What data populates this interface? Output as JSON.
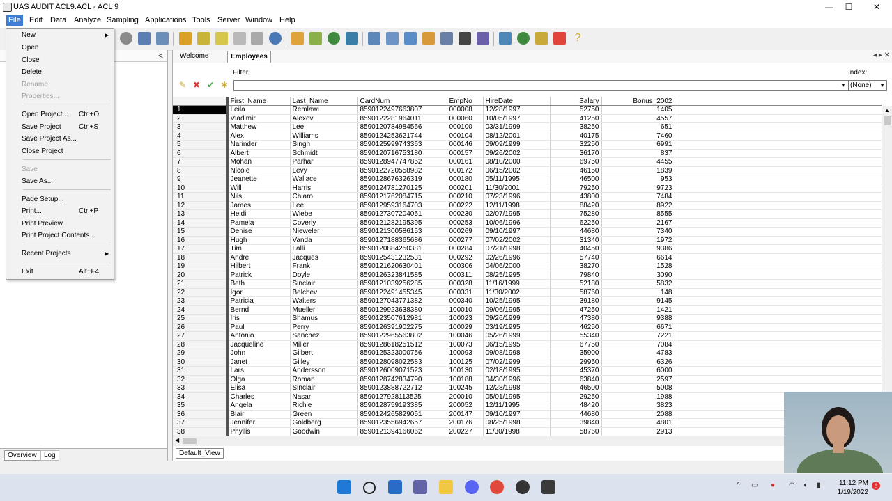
{
  "window": {
    "title": "UAS AUDIT ACL9.ACL - ACL 9",
    "minimize": "—",
    "maximize": "☐",
    "close": "✕"
  },
  "menubar": [
    "File",
    "Edit",
    "Data",
    "Analyze",
    "Sampling",
    "Applications",
    "Tools",
    "Server",
    "Window",
    "Help"
  ],
  "file_menu": {
    "items": [
      {
        "label": "New",
        "shortcut": "",
        "submenu": true,
        "enabled": true
      },
      {
        "label": "Open",
        "shortcut": "",
        "enabled": true
      },
      {
        "label": "Close",
        "shortcut": "",
        "enabled": true
      },
      {
        "label": "Delete",
        "shortcut": "",
        "enabled": true
      },
      {
        "label": "Rename",
        "shortcut": "",
        "enabled": false
      },
      {
        "label": "Properties...",
        "shortcut": "",
        "enabled": false
      },
      {
        "label": "Open Project...",
        "shortcut": "Ctrl+O",
        "enabled": true
      },
      {
        "label": "Save Project",
        "shortcut": "Ctrl+S",
        "enabled": true
      },
      {
        "label": "Save Project As...",
        "shortcut": "",
        "enabled": true
      },
      {
        "label": "Close Project",
        "shortcut": "",
        "enabled": true
      },
      {
        "label": "Save",
        "shortcut": "",
        "enabled": false
      },
      {
        "label": "Save As...",
        "shortcut": "",
        "enabled": true
      },
      {
        "label": "Page Setup...",
        "shortcut": "",
        "enabled": true
      },
      {
        "label": "Print...",
        "shortcut": "Ctrl+P",
        "enabled": true
      },
      {
        "label": "Print Preview",
        "shortcut": "",
        "enabled": true
      },
      {
        "label": "Print Project Contents...",
        "shortcut": "",
        "enabled": true
      },
      {
        "label": "Recent Projects",
        "shortcut": "",
        "submenu": true,
        "enabled": true
      },
      {
        "label": "Exit",
        "shortcut": "Alt+F4",
        "enabled": true
      }
    ]
  },
  "left_panel": {
    "collapse_glyph": "<",
    "tabs": [
      "Overview",
      "Log"
    ]
  },
  "doc_tabs": [
    {
      "label": "Welcome",
      "active": false
    },
    {
      "label": "Employees",
      "active": true
    }
  ],
  "filter": {
    "label": "Filter:",
    "value": ""
  },
  "index": {
    "label": "Index:",
    "value": "(None)"
  },
  "view_tab": "Default_View",
  "table": {
    "columns": [
      "First_Name",
      "Last_Name",
      "CardNum",
      "EmpNo",
      "HireDate",
      "Salary",
      "Bonus_2002"
    ],
    "rows": [
      [
        "1",
        "Leila",
        "Remlawi",
        "8590122497663807",
        "000008",
        "12/28/1997",
        "52750",
        "1405"
      ],
      [
        "2",
        "Vladimir",
        "Alexov",
        "8590122281964011",
        "000060",
        "10/05/1997",
        "41250",
        "4557"
      ],
      [
        "3",
        "Matthew",
        "Lee",
        "8590120784984566",
        "000100",
        "03/31/1999",
        "38250",
        "651"
      ],
      [
        "4",
        "Alex",
        "Williams",
        "8590124253621744",
        "000104",
        "08/12/2001",
        "40175",
        "7460"
      ],
      [
        "5",
        "Narinder",
        "Singh",
        "8590125999743363",
        "000146",
        "09/09/1999",
        "32250",
        "6991"
      ],
      [
        "6",
        "Albert",
        "Schmidt",
        "8590120716753180",
        "000157",
        "09/26/2002",
        "36170",
        "837"
      ],
      [
        "7",
        "Mohan",
        "Parhar",
        "8590128947747852",
        "000161",
        "08/10/2000",
        "69750",
        "4455"
      ],
      [
        "8",
        "Nicole",
        "Levy",
        "8590122720558982",
        "000172",
        "06/15/2002",
        "46150",
        "1839"
      ],
      [
        "9",
        "Jeanette",
        "Wallace",
        "8590128676326319",
        "000180",
        "05/11/1995",
        "46500",
        "953"
      ],
      [
        "10",
        "Will",
        "Harris",
        "8590124781270125",
        "000201",
        "11/30/2001",
        "79250",
        "9723"
      ],
      [
        "11",
        "Nils",
        "Chiaro",
        "8590121762084715",
        "000210",
        "07/23/1996",
        "43800",
        "7484"
      ],
      [
        "12",
        "James",
        "Lee",
        "8590129593164703",
        "000222",
        "12/11/1998",
        "88420",
        "8922"
      ],
      [
        "13",
        "Heidi",
        "Wiebe",
        "8590127307204051",
        "000230",
        "02/07/1995",
        "75280",
        "8555"
      ],
      [
        "14",
        "Pamela",
        "Coverly",
        "8590121282195395",
        "000253",
        "10/06/1996",
        "62250",
        "2167"
      ],
      [
        "15",
        "Denise",
        "Nieweler",
        "8590121300586153",
        "000269",
        "09/10/1997",
        "44680",
        "7340"
      ],
      [
        "16",
        "Hugh",
        "Vanda",
        "8590127188365686",
        "000277",
        "07/02/2002",
        "31340",
        "1972"
      ],
      [
        "17",
        "Tim",
        "Lalli",
        "8590120884250381",
        "000284",
        "07/21/1998",
        "40450",
        "9386"
      ],
      [
        "18",
        "Andre",
        "Jacques",
        "8590125431232531",
        "000292",
        "02/26/1996",
        "57740",
        "6614"
      ],
      [
        "19",
        "Hilbert",
        "Frank",
        "8590121620630401",
        "000306",
        "04/06/2000",
        "38270",
        "1528"
      ],
      [
        "20",
        "Patrick",
        "Doyle",
        "8590126323841585",
        "000311",
        "08/25/1995",
        "79840",
        "3090"
      ],
      [
        "21",
        "Beth",
        "Sinclair",
        "8590121039256285",
        "000328",
        "11/16/1999",
        "52180",
        "5832"
      ],
      [
        "22",
        "Igor",
        "Belchev",
        "8590122491455345",
        "000331",
        "11/30/2002",
        "58760",
        "148"
      ],
      [
        "23",
        "Patricia",
        "Walters",
        "8590127043771382",
        "000340",
        "10/25/1995",
        "39180",
        "9145"
      ],
      [
        "24",
        "Bernd",
        "Mueller",
        "8590129923638380",
        "100010",
        "09/06/1995",
        "47250",
        "1421"
      ],
      [
        "25",
        "Iris",
        "Shamus",
        "8590123507612981",
        "100023",
        "09/26/1999",
        "47380",
        "9388"
      ],
      [
        "26",
        "Paul",
        "Perry",
        "8590126391902275",
        "100029",
        "03/19/1995",
        "46250",
        "6671"
      ],
      [
        "27",
        "Antonio",
        "Sanchez",
        "8590122965563802",
        "100046",
        "05/26/1999",
        "55340",
        "7221"
      ],
      [
        "28",
        "Jacqueline",
        "Miller",
        "8590128618251512",
        "100073",
        "06/15/1995",
        "67750",
        "7084"
      ],
      [
        "29",
        "John",
        "Gilbert",
        "8590125323000756",
        "100093",
        "09/08/1998",
        "35900",
        "4783"
      ],
      [
        "30",
        "Janet",
        "Gilley",
        "8590128098022583",
        "100125",
        "07/02/1999",
        "29950",
        "6326"
      ],
      [
        "31",
        "Lars",
        "Andersson",
        "8590126009071523",
        "100130",
        "02/18/1995",
        "45370",
        "6000"
      ],
      [
        "32",
        "Olga",
        "Roman",
        "8590128742834790",
        "100188",
        "04/30/1996",
        "63840",
        "2597"
      ],
      [
        "33",
        "Elisa",
        "Sinclair",
        "8590123888722712",
        "100245",
        "12/28/1998",
        "46500",
        "5008"
      ],
      [
        "34",
        "Charles",
        "Nasar",
        "8590127928113525",
        "200010",
        "05/01/1995",
        "29250",
        "1988"
      ],
      [
        "35",
        "Angela",
        "Richie",
        "8590128759193385",
        "200052",
        "12/11/1995",
        "48420",
        "3823"
      ],
      [
        "36",
        "Blair",
        "Green",
        "8590124265829051",
        "200147",
        "09/10/1997",
        "44680",
        "2088"
      ],
      [
        "37",
        "Jennifer",
        "Goldberg",
        "8590123556942657",
        "200176",
        "08/25/1998",
        "39840",
        "4801"
      ],
      [
        "38",
        "Phyllis",
        "Goodwin",
        "8590121394166062",
        "200227",
        "11/30/1998",
        "58760",
        "2913"
      ]
    ]
  },
  "taskbar": {
    "time": "11:12 PM",
    "date": "1/19/2022"
  },
  "colors": {
    "menu_highlight": "#3d7ed6",
    "taskbar": "#dde3ee"
  }
}
